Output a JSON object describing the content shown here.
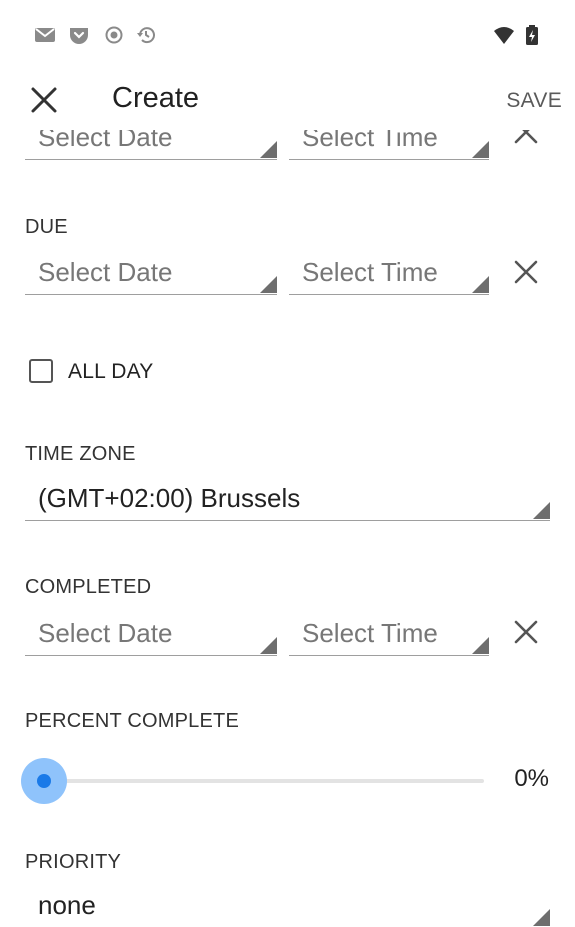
{
  "status_bar": {
    "left_icons": [
      "mail-icon",
      "pocket-icon",
      "record-icon",
      "sync-history-icon"
    ],
    "right_icons": [
      "wifi-icon",
      "battery-icon"
    ]
  },
  "app_bar": {
    "title": "Create",
    "save_label": "SAVE",
    "close_icon": "close-icon"
  },
  "form": {
    "start": {
      "date_placeholder": "Select Date",
      "time_placeholder": "Select Time"
    },
    "due": {
      "label": "DUE",
      "date_placeholder": "Select Date",
      "time_placeholder": "Select Time"
    },
    "all_day": {
      "label": "ALL DAY",
      "checked": false
    },
    "time_zone": {
      "label": "TIME ZONE",
      "value": "(GMT+02:00) Brussels"
    },
    "completed": {
      "label": "COMPLETED",
      "date_placeholder": "Select Date",
      "time_placeholder": "Select Time"
    },
    "percent_complete": {
      "label": "PERCENT COMPLETE",
      "value_text": "0%",
      "fraction": 0
    },
    "priority": {
      "label": "PRIORITY",
      "value": "none"
    }
  },
  "colors": {
    "accent": "#1a7ae8",
    "accent_halo": "#8fc3fb"
  }
}
